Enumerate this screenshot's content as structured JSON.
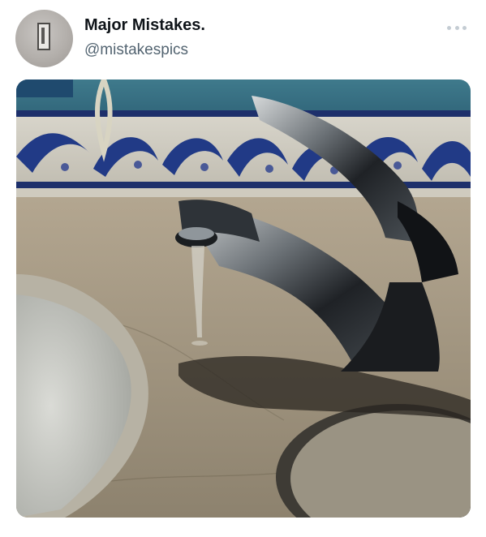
{
  "tweet": {
    "display_name": "Major Mistakes.",
    "handle": "@mistakespics"
  },
  "icons": {
    "more": "more-horizontal-icon"
  },
  "colors": {
    "name_text": "#0f1419",
    "handle_text": "#536471",
    "icon_gray": "#c4ccd3"
  }
}
